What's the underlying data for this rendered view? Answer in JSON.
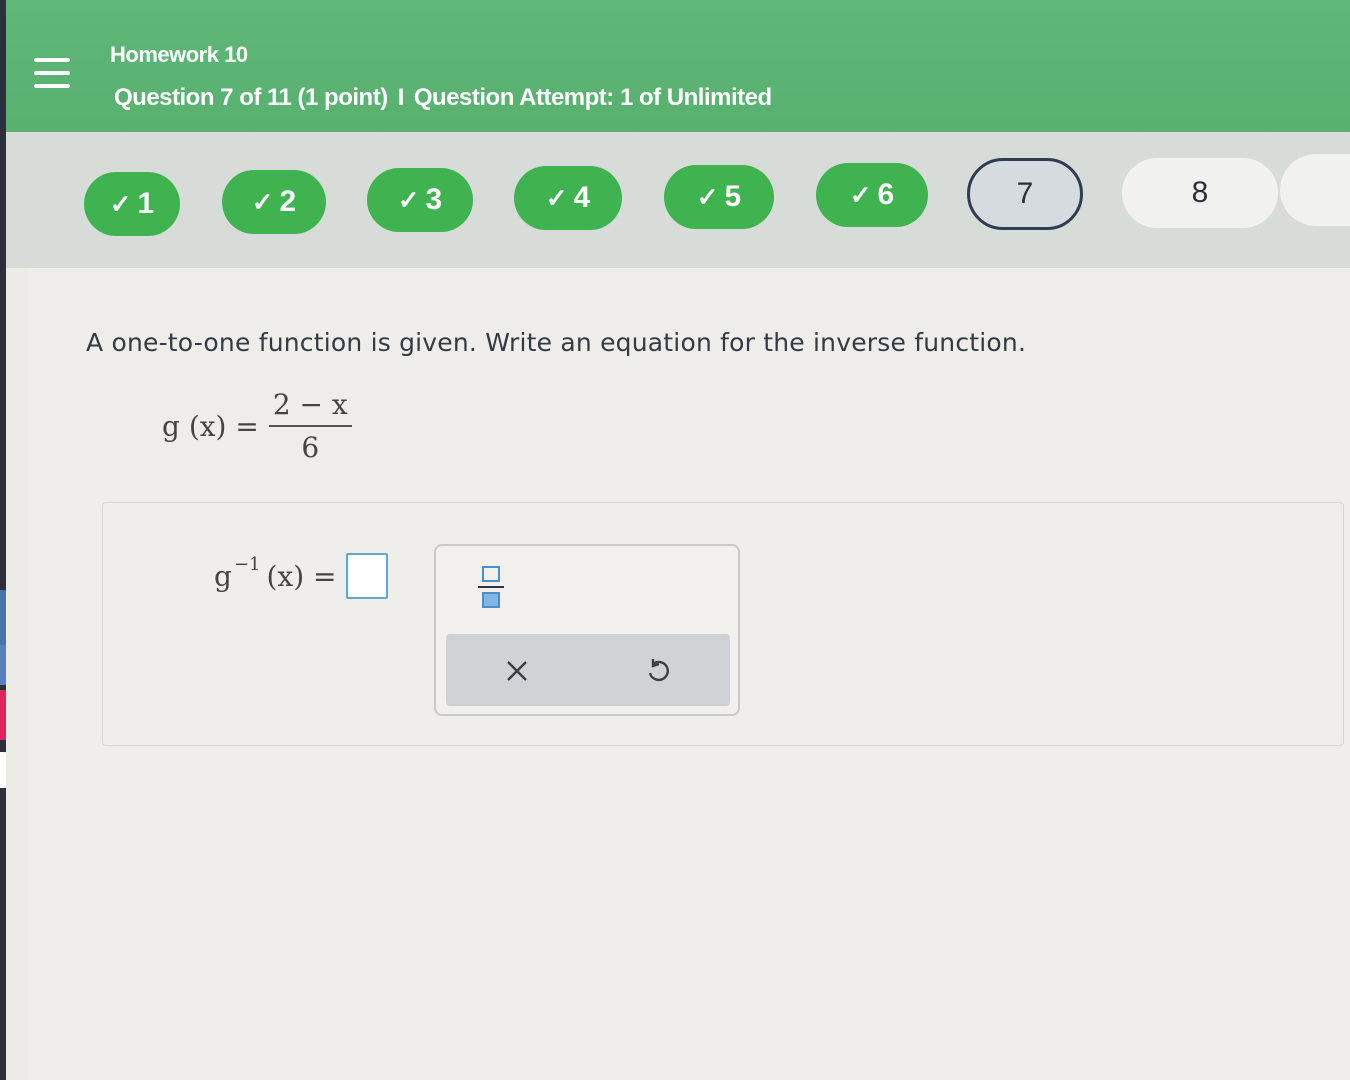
{
  "header": {
    "title": "Homework 10",
    "question_label": "Question 7 of 11 (1 point)",
    "separator": "I",
    "attempt_label": "Question Attempt: 1 of Unlimited"
  },
  "question_nav": [
    {
      "label": "1",
      "status": "completed",
      "check": "✓"
    },
    {
      "label": "2",
      "status": "completed",
      "check": "✓"
    },
    {
      "label": "3",
      "status": "completed",
      "check": "✓"
    },
    {
      "label": "4",
      "status": "completed",
      "check": "✓"
    },
    {
      "label": "5",
      "status": "completed",
      "check": "✓"
    },
    {
      "label": "6",
      "status": "completed",
      "check": "✓"
    },
    {
      "label": "7",
      "status": "current"
    },
    {
      "label": "8",
      "status": "not-started"
    }
  ],
  "problem": {
    "prompt": "A one-to-one function is given. Write an equation for the inverse function.",
    "given_lhs": "g (x) =",
    "given_numerator": "2 − x",
    "given_denominator": "6"
  },
  "answer": {
    "lhs_base": "g",
    "lhs_sup": "−1",
    "lhs_rest": "(x) ="
  },
  "palette": {
    "tools": [
      "fraction-icon"
    ],
    "actions": [
      "clear-icon",
      "undo-icon"
    ]
  },
  "colors": {
    "header_green": "#5fb878",
    "completed_green": "#3fb34f",
    "current_border": "#2e3d4f",
    "input_blue": "#5aa9d8"
  }
}
